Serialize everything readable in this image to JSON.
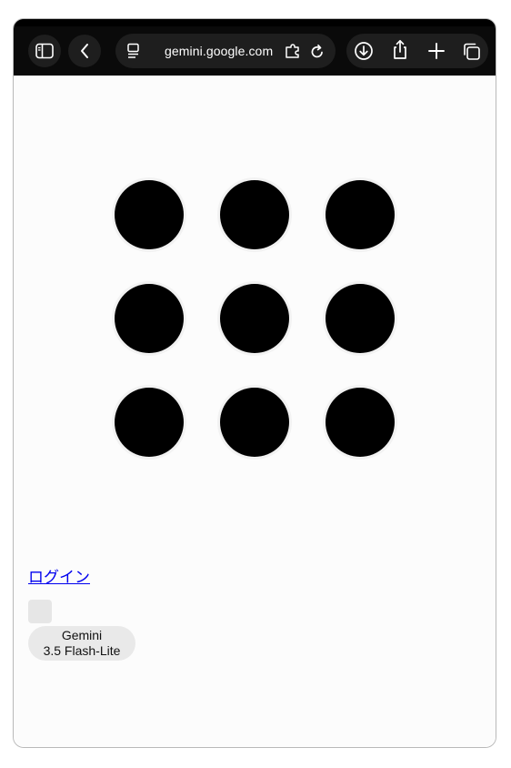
{
  "browser": {
    "url": "gemini.google.com",
    "icons": {
      "sidebar": "sidebar-icon",
      "back": "chevron-left-icon",
      "page_menu": "page-menu-icon",
      "extensions": "extensions-icon",
      "reload": "reload-icon",
      "download": "download-icon",
      "share": "share-icon",
      "new_tab": "plus-icon",
      "tabs": "tabs-icon"
    }
  },
  "page": {
    "loading_grid": {
      "rows": 3,
      "cols": 3,
      "dot_color": "#000000"
    },
    "login_link": "ログイン",
    "model_selector": {
      "line1": "Gemini",
      "line2": "3.5 Flash-Lite"
    }
  }
}
